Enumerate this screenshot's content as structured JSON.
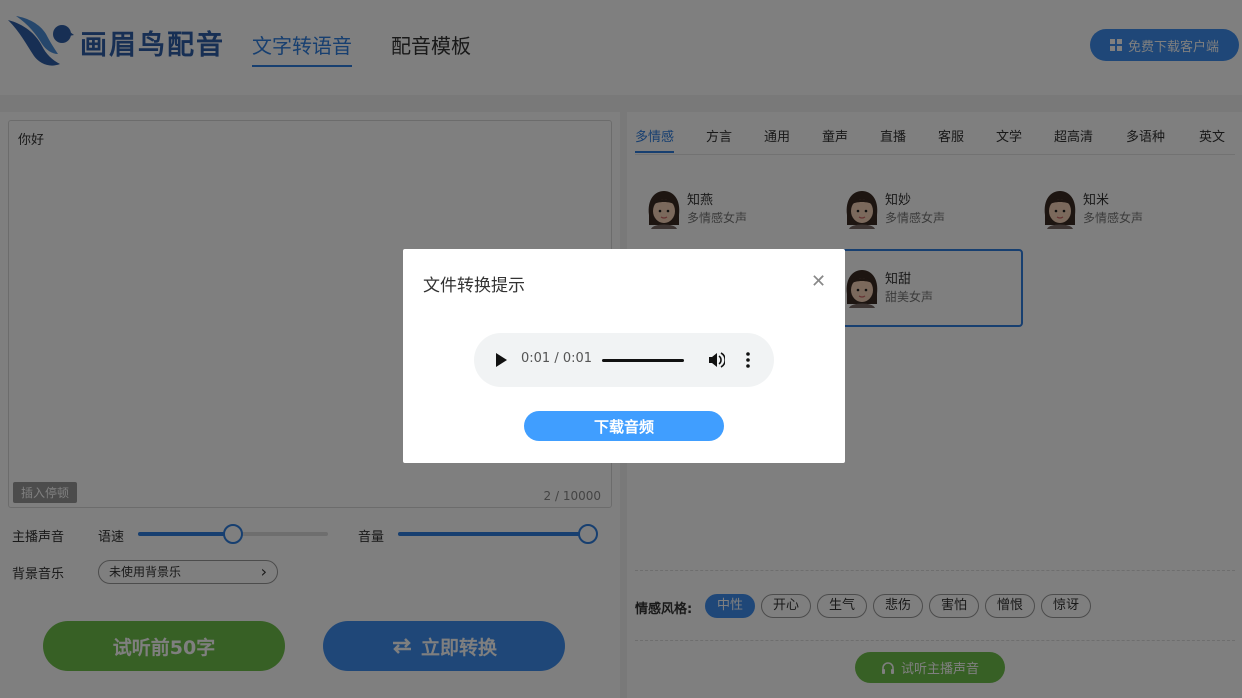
{
  "header": {
    "logo_text": "画眉鸟配音",
    "nav_tabs": [
      {
        "label": "文字转语音",
        "active": true
      },
      {
        "label": "配音模板",
        "active": false
      }
    ],
    "download_client_label": "免费下载客户端",
    "download_client_icon": "windows-icon"
  },
  "editor": {
    "text": "你好",
    "insert_pause_label": "插入停顿",
    "char_count": "2 / 10000"
  },
  "controls": {
    "anchor_voice_label": "主播声音",
    "speed_label": "语速",
    "speed_value": 0.5,
    "volume_label": "音量",
    "volume_value": 1.0,
    "bg_music_label": "背景音乐",
    "bg_music_value": "未使用背景乐"
  },
  "actions": {
    "preview_label": "试听前50字",
    "convert_label": "立即转换",
    "convert_icon": "swap-arrows-icon"
  },
  "voice_panel": {
    "categories": [
      {
        "label": "多情感",
        "active": true
      },
      {
        "label": "方言"
      },
      {
        "label": "通用"
      },
      {
        "label": "童声"
      },
      {
        "label": "直播"
      },
      {
        "label": "客服"
      },
      {
        "label": "文学"
      },
      {
        "label": "超高清"
      },
      {
        "label": "多语种"
      },
      {
        "label": "英文"
      }
    ],
    "voices": [
      {
        "name": "知燕",
        "desc": "多情感女声"
      },
      {
        "name": "知妙",
        "desc": "多情感女声"
      },
      {
        "name": "知米",
        "desc": "多情感女声"
      },
      {
        "name": "知甜",
        "desc": "甜美女声",
        "selected": true
      }
    ],
    "emotion_label": "情感风格:",
    "emotions": [
      {
        "label": "中性",
        "active": true
      },
      {
        "label": "开心"
      },
      {
        "label": "生气"
      },
      {
        "label": "悲伤"
      },
      {
        "label": "害怕"
      },
      {
        "label": "憎恨"
      },
      {
        "label": "惊讶"
      }
    ],
    "preview_voice_label": "试听主播声音",
    "preview_voice_icon": "headphones-icon"
  },
  "modal": {
    "title": "文件转换提示",
    "close_icon": "close-icon",
    "audio_time": "0:01 / 0:01",
    "audio_progress": 1.0,
    "download_label": "下载音频"
  },
  "colors": {
    "accent_blue": "#3e8ff0",
    "accent_green": "#6ec04a",
    "brand_blue": "#2f5fa8"
  }
}
